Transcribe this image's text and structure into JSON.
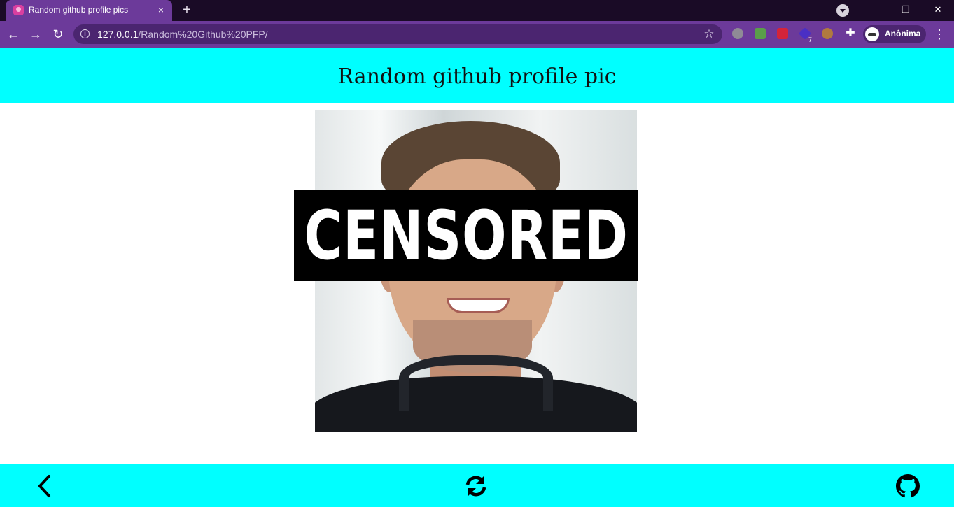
{
  "browser": {
    "tab": {
      "title": "Random github profile pics",
      "close": "×"
    },
    "new_tab": "+",
    "window": {
      "minimize": "—",
      "restore": "❐",
      "close": "✕"
    },
    "nav": {
      "back": "←",
      "forward": "→",
      "reload": "↻"
    },
    "address": {
      "host": "127.0.0.1",
      "path": "/Random%20Github%20PFP/"
    },
    "bookmark_star": "☆",
    "extensions": [
      {
        "name": "cloud-extension-icon",
        "color": "#8f8a96"
      },
      {
        "name": "money-extension-icon",
        "color": "#5a9e4a"
      },
      {
        "name": "red-play-extension-icon",
        "color": "#d4243a"
      },
      {
        "name": "purple-cube-extension-icon",
        "color": "#4a2fc4",
        "badge": "7"
      },
      {
        "name": "cookie-extension-icon",
        "color": "#b07a3e"
      }
    ],
    "extensions_menu": "✚",
    "profile": {
      "label": "Anônima"
    },
    "menu": "⋮"
  },
  "page": {
    "title": "Random github profile pic",
    "censor_text": "CENSORED",
    "colors": {
      "header_bg": "#00ffff",
      "footer_bg": "#00ffff",
      "censor_bg": "#000000"
    },
    "footer": {
      "back_icon": "chevron-left-icon",
      "refresh_icon": "sync-icon",
      "github_icon": "github-icon"
    }
  }
}
